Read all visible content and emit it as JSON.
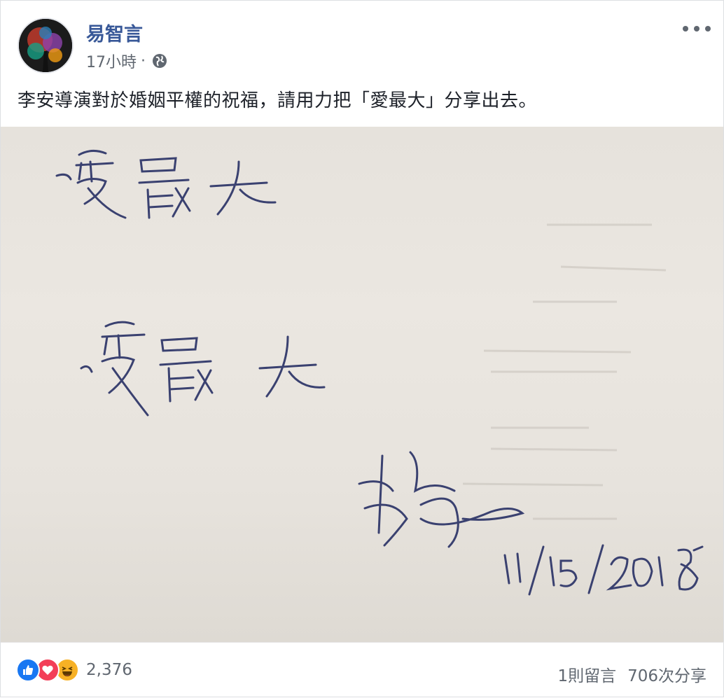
{
  "post": {
    "author": "易智言",
    "time": "17小時",
    "separator": "·",
    "privacy_icon": "globe-icon",
    "more_icon": "more-options-icon",
    "text": "李安導演對於婚姻平權的祝福，請用力把「愛最大」分享出去。"
  },
  "photo": {
    "handwriting_line1": "愛最大",
    "handwriting_line2": "愛最大",
    "signature": "李安",
    "date": "11/15/2018"
  },
  "footer": {
    "reaction_icons": [
      "like-icon",
      "love-icon",
      "haha-icon"
    ],
    "reaction_count": "2,376",
    "comments": "1則留言",
    "shares": "706次分享"
  },
  "colors": {
    "author_link": "#385898",
    "meta_text": "#606770",
    "like_blue": "#1877f2",
    "love_red": "#f33e58",
    "haha_yellow": "#f7b125"
  }
}
